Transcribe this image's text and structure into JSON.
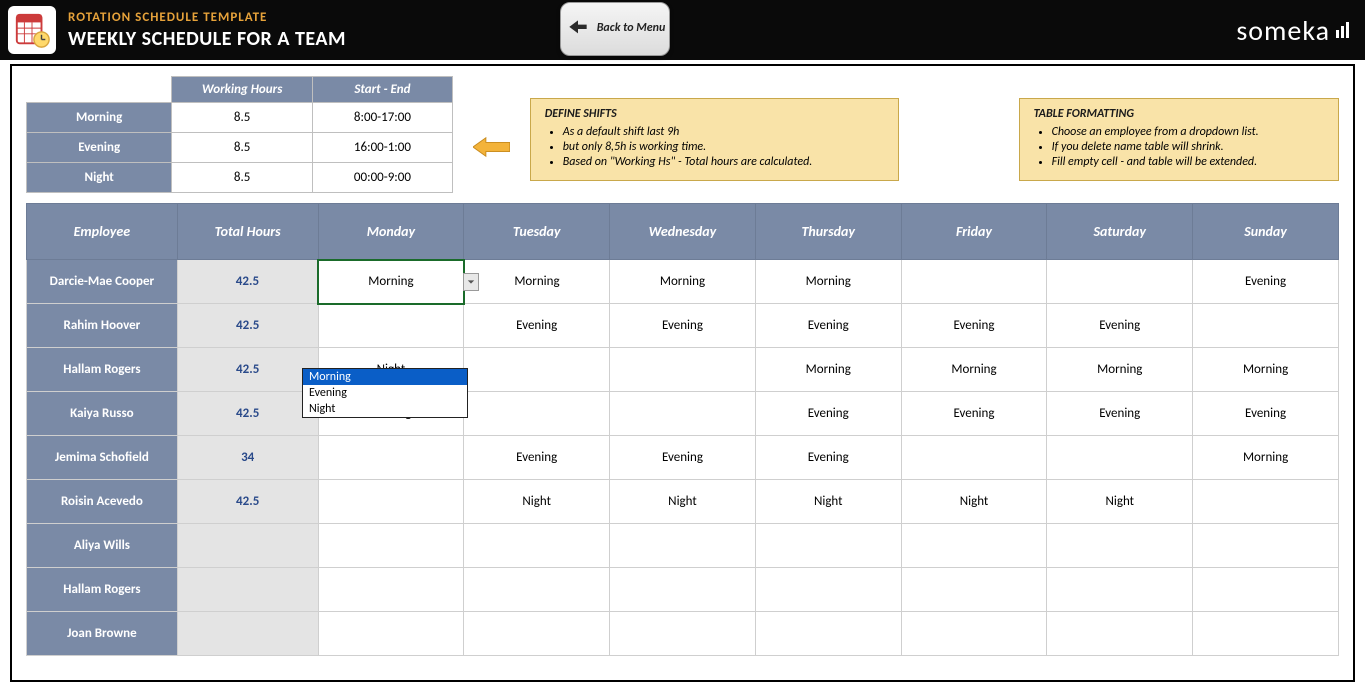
{
  "header": {
    "title1": "ROTATION SCHEDULE TEMPLATE",
    "title2": "WEEKLY SCHEDULE FOR A TEAM",
    "back_label": "Back to Menu",
    "logo": "someka"
  },
  "shifts": {
    "col_hours": "Working Hours",
    "col_range": "Start - End",
    "rows": [
      {
        "name": "Morning",
        "hours": "8.5",
        "range": "8:00-17:00"
      },
      {
        "name": "Evening",
        "hours": "8.5",
        "range": "16:00-1:00"
      },
      {
        "name": "Night",
        "hours": "8.5",
        "range": "00:00-9:00"
      }
    ]
  },
  "notes": {
    "define_title": "DEFINE SHIFTS",
    "define_items": [
      "As a default shift last 9h",
      "but only 8,5h is working time.",
      "Based on \"Working Hs\" - Total hours are calculated."
    ],
    "format_title": "TABLE FORMATTING",
    "format_items": [
      "Choose an employee from a dropdown list.",
      "If you delete name table will shrink.",
      "Fill empty cell - and table will be extended."
    ]
  },
  "schedule": {
    "headers": [
      "Employee",
      "Total Hours",
      "Monday",
      "Tuesday",
      "Wednesday",
      "Thursday",
      "Friday",
      "Saturday",
      "Sunday"
    ],
    "rows": [
      {
        "emp": "Darcie-Mae Cooper",
        "hrs": "42.5",
        "d": [
          "Morning",
          "Morning",
          "Morning",
          "Morning",
          "",
          "",
          "Evening"
        ]
      },
      {
        "emp": "Rahim Hoover",
        "hrs": "42.5",
        "d": [
          "",
          "Evening",
          "Evening",
          "Evening",
          "Evening",
          "Evening",
          ""
        ]
      },
      {
        "emp": "Hallam Rogers",
        "hrs": "42.5",
        "d": [
          "Night",
          "",
          "",
          "Morning",
          "Morning",
          "Morning",
          "Morning"
        ]
      },
      {
        "emp": "Kaiya Russo",
        "hrs": "42.5",
        "d": [
          "Evening",
          "",
          "",
          "Evening",
          "Evening",
          "Evening",
          "Evening"
        ]
      },
      {
        "emp": "Jemima Schofield",
        "hrs": "34",
        "d": [
          "",
          "Evening",
          "Evening",
          "Evening",
          "",
          "",
          "Morning"
        ]
      },
      {
        "emp": "Roisin Acevedo",
        "hrs": "42.5",
        "d": [
          "",
          "Night",
          "Night",
          "Night",
          "Night",
          "Night",
          ""
        ]
      },
      {
        "emp": "Aliya Wills",
        "hrs": "",
        "d": [
          "",
          "",
          "",
          "",
          "",
          "",
          ""
        ]
      },
      {
        "emp": "Hallam Rogers",
        "hrs": "",
        "d": [
          "",
          "",
          "",
          "",
          "",
          "",
          ""
        ]
      },
      {
        "emp": "Joan Browne",
        "hrs": "",
        "d": [
          "",
          "",
          "",
          "",
          "",
          "",
          ""
        ]
      }
    ]
  },
  "dropdown": {
    "options": [
      "Morning",
      "Evening",
      "Night"
    ],
    "selected": "Morning"
  }
}
